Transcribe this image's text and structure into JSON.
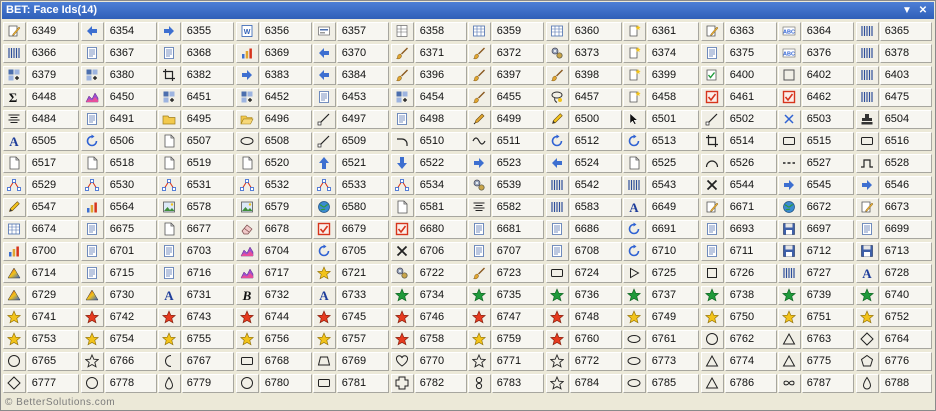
{
  "window": {
    "title": "BET: Face Ids(14)"
  },
  "footer": {
    "text": "© BetterSolutions.com"
  },
  "rows": [
    [
      "6349",
      "6354",
      "6355",
      "6356",
      "6357",
      "6358",
      "6359",
      "6360",
      "6361",
      "6363",
      "6364",
      "6365"
    ],
    [
      "6366",
      "6367",
      "6368",
      "6369",
      "6370",
      "6371",
      "6372",
      "6373",
      "6374",
      "6375",
      "6376",
      "6378"
    ],
    [
      "6379",
      "6380",
      "6382",
      "6383",
      "6384",
      "6396",
      "6397",
      "6398",
      "6399",
      "6400",
      "6402",
      "6403"
    ],
    [
      "6448",
      "6450",
      "6451",
      "6452",
      "6453",
      "6454",
      "6455",
      "6457",
      "6458",
      "6461",
      "6462",
      "6475"
    ],
    [
      "6484",
      "6491",
      "6495",
      "6496",
      "6497",
      "6498",
      "6499",
      "6500",
      "6501",
      "6502",
      "6503",
      "6504"
    ],
    [
      "6505",
      "6506",
      "6507",
      "6508",
      "6509",
      "6510",
      "6511",
      "6512",
      "6513",
      "6514",
      "6515",
      "6516"
    ],
    [
      "6517",
      "6518",
      "6519",
      "6520",
      "6521",
      "6522",
      "6523",
      "6524",
      "6525",
      "6526",
      "6527",
      "6528"
    ],
    [
      "6529",
      "6530",
      "6531",
      "6532",
      "6533",
      "6534",
      "6539",
      "6542",
      "6543",
      "6544",
      "6545",
      "6546"
    ],
    [
      "6547",
      "6564",
      "6578",
      "6579",
      "6580",
      "6581",
      "6582",
      "6583",
      "6649",
      "6671",
      "6672",
      "6673"
    ],
    [
      "6674",
      "6675",
      "6677",
      "6678",
      "6679",
      "6680",
      "6681",
      "6686",
      "6691",
      "6693",
      "6697",
      "6699"
    ],
    [
      "6700",
      "6701",
      "6703",
      "6704",
      "6705",
      "6706",
      "6707",
      "6708",
      "6710",
      "6711",
      "6712",
      "6713"
    ],
    [
      "6714",
      "6715",
      "6716",
      "6717",
      "6721",
      "6722",
      "6723",
      "6724",
      "6725",
      "6726",
      "6727",
      "6728"
    ],
    [
      "6729",
      "6730",
      "6731",
      "6732",
      "6733",
      "6734",
      "6735",
      "6736",
      "6737",
      "6738",
      "6739",
      "6740"
    ],
    [
      "6741",
      "6742",
      "6743",
      "6744",
      "6745",
      "6746",
      "6747",
      "6748",
      "6749",
      "6750",
      "6751",
      "6752"
    ],
    [
      "6753",
      "6754",
      "6755",
      "6756",
      "6757",
      "6758",
      "6759",
      "6760",
      "6761",
      "6762",
      "6763",
      "6764"
    ],
    [
      "6765",
      "6766",
      "6767",
      "6768",
      "6769",
      "6770",
      "6771",
      "6772",
      "6773",
      "6774",
      "6775",
      "6776"
    ],
    [
      "6777",
      "6778",
      "6779",
      "6780",
      "6781",
      "6782",
      "6783",
      "6784",
      "6785",
      "6786",
      "6787",
      "6788"
    ]
  ],
  "icons": [
    [
      "edit-doc-icon",
      "arrow-left-icon",
      "arrow-right-icon",
      "word-doc-icon",
      "form-icon",
      "ledger-icon",
      "table-icon",
      "table-icon",
      "doc-star-icon",
      "edit-doc-icon",
      "abc-icon",
      "columns-icon"
    ],
    [
      "columns-icon",
      "doc-list-icon",
      "doc-list-icon",
      "chart-tool-icon",
      "arrow-left-icon",
      "brush-icon",
      "brush-icon",
      "gears-icon",
      "doc-star-icon",
      "doc-list-icon",
      "abc-icon",
      "columns-icon"
    ],
    [
      "grid-add-icon",
      "grid-add-icon",
      "crop-icon",
      "arrow-right-icon",
      "arrow-left-icon",
      "brush-icon",
      "brush-icon",
      "brush-icon",
      "doc-star-icon",
      "check-doc-icon",
      "curve-icon",
      "columns-icon"
    ],
    [
      "sigma-icon",
      "area-chart-icon",
      "grid-add-icon",
      "grid-add-icon",
      "doc-list-icon",
      "grid-add-icon",
      "brush-icon",
      "lasso-icon",
      "doc-star-icon",
      "red-check-icon",
      "red-check-icon",
      "columns-icon"
    ],
    [
      "align-icon",
      "doc-list-icon",
      "folder-icon",
      "folder-open-icon",
      "line-tool-icon",
      "doc-list-icon",
      "pen-icon",
      "pencil-icon",
      "cursor-icon",
      "line-tool-icon",
      "x-blue-icon",
      "stamp-icon"
    ],
    [
      "letter-a-icon",
      "refresh-icon",
      "doc-icon",
      "ellipse-icon",
      "line-tool-icon",
      "corner-icon",
      "wave-icon",
      "refresh-icon",
      "refresh-icon",
      "crop-icon",
      "rectangle-icon",
      "rectangle-icon"
    ],
    [
      "doc-icon",
      "doc-icon",
      "doc-icon",
      "doc-icon",
      "arrow-up-icon",
      "arrow-down-icon",
      "arrow-right-icon",
      "arrow-left-icon",
      "doc-icon",
      "arc-icon",
      "dash-icon",
      "step-icon"
    ],
    [
      "node-icon",
      "node-icon",
      "node-icon",
      "node-icon",
      "node-icon",
      "node-icon",
      "gears-icon",
      "columns-icon",
      "columns-icon",
      "x-black-icon",
      "arrow-right-icon",
      "arrow-right-icon"
    ],
    [
      "pencil-icon",
      "chart-tool-icon",
      "picture-icon",
      "picture-icon",
      "globe-icon",
      "doc-icon",
      "align-icon",
      "columns-icon",
      "letter-a-icon",
      "edit-doc-icon",
      "globe-icon",
      "edit-doc-icon"
    ],
    [
      "table-icon",
      "doc-list-icon",
      "doc-icon",
      "eraser-icon",
      "red-check-icon",
      "red-check-icon",
      "doc-list-icon",
      "doc-list-icon",
      "refresh-icon",
      "doc-list-icon",
      "floppy-icon",
      "doc-list-icon"
    ],
    [
      "chart-tool-icon",
      "doc-list-icon",
      "doc-list-icon",
      "area-chart-icon",
      "refresh-icon",
      "x-black-icon",
      "doc-list-icon",
      "doc-list-icon",
      "refresh-icon",
      "doc-list-icon",
      "floppy-icon",
      "floppy-icon"
    ],
    [
      "gradient-icon",
      "doc-list-icon",
      "doc-list-icon",
      "area-chart-icon",
      "star-yellow-icon",
      "gears-icon",
      "brush-icon",
      "rectangle-icon",
      "play-icon",
      "square-outline-icon",
      "columns-icon",
      "letter-a-icon"
    ],
    [
      "gradient-icon",
      "gradient-icon",
      "letter-a-icon",
      "bold-b-icon",
      "letter-a-icon",
      "star-green-icon",
      "star-green-icon",
      "star-green-icon",
      "star-green-icon",
      "star-green-icon",
      "star-green-icon",
      "star-green-icon"
    ],
    [
      "star-yellow-icon",
      "star-red-icon",
      "star-red-icon",
      "star-red-icon",
      "star-red-icon",
      "star-red-icon",
      "star-red-icon",
      "star-red-icon",
      "star-yellow-icon",
      "star-yellow-icon",
      "star-yellow-icon",
      "star-yellow-icon"
    ],
    [
      "star-yellow-icon",
      "star-yellow-icon",
      "star-yellow-icon",
      "star-yellow-icon",
      "star-yellow-icon",
      "star-red-icon",
      "star-yellow-icon",
      "star-red-icon",
      "ellipse-icon",
      "circle-outline-icon",
      "triangle-outline-icon",
      "diamond-outline-icon"
    ],
    [
      "circle-outline-icon",
      "star-outline-icon",
      "moon-outline-icon",
      "rectangle-icon",
      "trapezoid-outline-icon",
      "heart-outline-icon",
      "star-outline-icon",
      "star-outline-icon",
      "ellipse-icon",
      "triangle-outline-icon",
      "triangle-outline-icon",
      "pentagon-outline-icon"
    ],
    [
      "diamond-outline-icon",
      "circle-outline-icon",
      "drop-outline-icon",
      "circle-outline-icon",
      "rectangle-icon",
      "cross-outline-icon",
      "figure8-outline-icon",
      "star-outline-icon",
      "ellipse-icon",
      "triangle-outline-icon",
      "infinity-icon",
      "drop-outline-icon"
    ]
  ]
}
